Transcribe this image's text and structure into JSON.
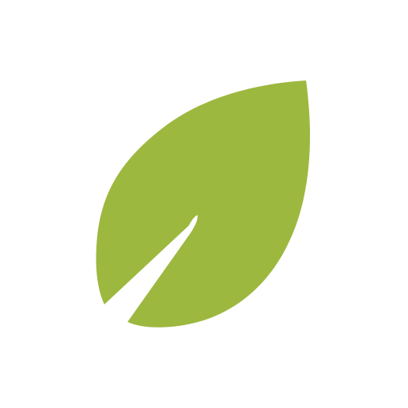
{
  "icon": {
    "name": "leaf-icon",
    "color": "#9db83f",
    "background": "#ffffff"
  }
}
